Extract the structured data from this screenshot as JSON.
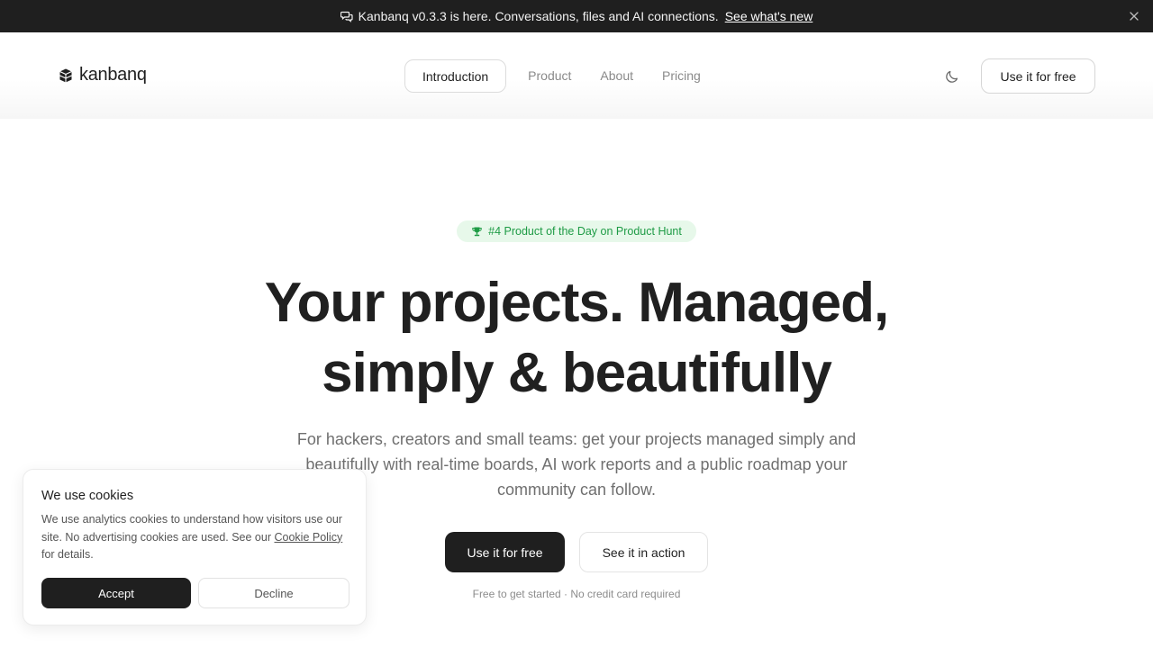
{
  "announcement": {
    "icon": "chat-bubbles-icon",
    "text": "Kanbanq v0.3.3 is here. Conversations, files and AI connections.",
    "link_label": "See what's new",
    "close_icon": "close-icon"
  },
  "header": {
    "logo_text": "kanbanq",
    "logo_icon": "cube-stack-icon",
    "nav": [
      {
        "label": "Introduction",
        "active": true
      },
      {
        "label": "Product"
      },
      {
        "label": "About"
      },
      {
        "label": "Pricing"
      }
    ],
    "theme_toggle_icon": "moon-icon",
    "cta_label": "Use it for free"
  },
  "hero": {
    "badge_icon": "trophy-icon",
    "badge_text": "#4 Product of the Day on Product Hunt",
    "headline_line1": "Your projects. Managed,",
    "headline_line2": "simply & beautifully",
    "subtitle": "For hackers, creators and small teams: get your projects managed simply and beautifully with real-time boards, AI work reports and a public roadmap your community can follow.",
    "primary_cta": "Use it for free",
    "secondary_cta": "See it in action",
    "fineprint": "Free to get started · No credit card required"
  },
  "cookie": {
    "title": "We use cookies",
    "body_before_link": "We use analytics cookies to understand how visitors use our site. No advertising cookies are used. See our ",
    "link_label": "Cookie Policy",
    "body_after_link": " for details.",
    "accept_label": "Accept",
    "decline_label": "Decline"
  },
  "colors": {
    "dark": "#1f1f1f",
    "badge_bg": "#e7f8ea",
    "badge_text": "#1e9b45",
    "muted_text": "#6f6f6f"
  }
}
